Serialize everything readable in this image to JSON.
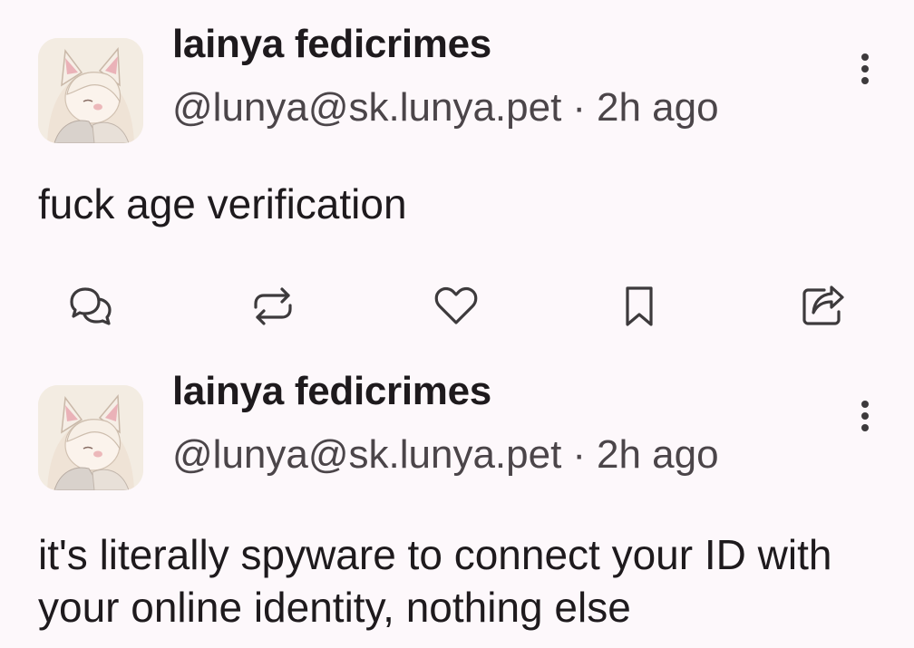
{
  "posts": [
    {
      "display_name": "lainya fedicrimes",
      "handle": "@lunya@sk.lunya.pet",
      "separator": "·",
      "timestamp": "2h ago",
      "content": "fuck age verification",
      "avatar_icon": "anime-catgirl-avatar",
      "actions": [
        "reply-icon",
        "boost-icon",
        "like-icon",
        "bookmark-icon",
        "share-icon"
      ]
    },
    {
      "display_name": "lainya fedicrimes",
      "handle": "@lunya@sk.lunya.pet",
      "separator": "·",
      "timestamp": "2h ago",
      "content": "it's literally spyware to connect your ID with your online identity, nothing else",
      "avatar_icon": "anime-catgirl-avatar"
    }
  ],
  "colors": {
    "background": "#fdf8fb",
    "text": "#1e1a1d",
    "secondary_text": "#4b4549",
    "icon": "#3d3a3c"
  }
}
